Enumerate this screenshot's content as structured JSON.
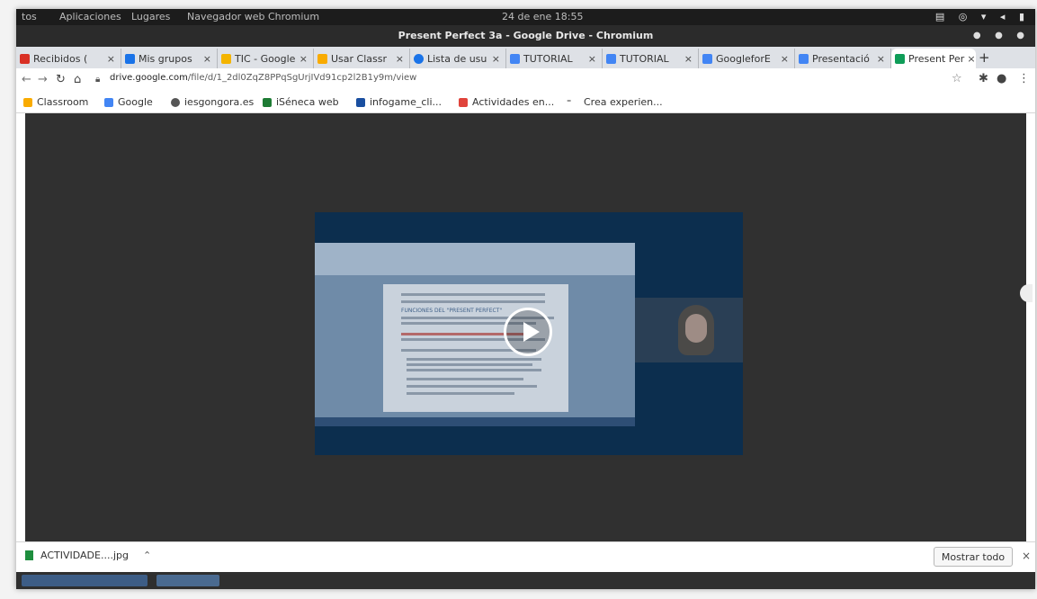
{
  "topbar": {
    "activities": "tos",
    "menu_apps": "Aplicaciones",
    "menu_places": "Lugares",
    "menu_browser": "Navegador web Chromium",
    "clock": "24 de ene 18:55"
  },
  "window": {
    "title": "Present Perfect 3a - Google Drive - Chromium"
  },
  "tabs": [
    {
      "label": "Recibidos (",
      "icon": "gmail-icon",
      "color": "#d93025"
    },
    {
      "label": "Mis grupos",
      "icon": "groups-icon",
      "color": "#1a73e8"
    },
    {
      "label": "TIC - Google",
      "icon": "drive-icon",
      "color": "#f4b400"
    },
    {
      "label": "Usar Classr",
      "icon": "classroom-icon",
      "color": "#f9ab00"
    },
    {
      "label": "Lista de usu",
      "icon": "chrome-icon",
      "color": "#1a73e8"
    },
    {
      "label": "TUTORIAL",
      "icon": "docs-icon",
      "color": "#4285f4"
    },
    {
      "label": "TUTORIAL",
      "icon": "docs-icon",
      "color": "#4285f4"
    },
    {
      "label": "GoogleforE",
      "icon": "docs-icon",
      "color": "#4285f4"
    },
    {
      "label": "Presentació",
      "icon": "person-icon",
      "color": "#4285f4"
    },
    {
      "label": "Present Per",
      "icon": "drive-icon",
      "color": "#0f9d58"
    }
  ],
  "address": {
    "url_domain": "drive.google.com",
    "url_path": "/file/d/1_2dl0ZqZ8PPqSgUrjIVd91cp2l2B1y9m/view"
  },
  "bookmarks": [
    {
      "label": "Classroom",
      "icon": "classroom-icon",
      "color": "#f9ab00"
    },
    {
      "label": "Google",
      "icon": "google-icon",
      "color": "#4285f4"
    },
    {
      "label": "iesgongora.es",
      "icon": "globe-icon",
      "color": "#555555"
    },
    {
      "label": "iSéneca web",
      "icon": "seneca-icon",
      "color": "#1e7b34"
    },
    {
      "label": "infogame_cli...",
      "icon": "infogame-icon",
      "color": "#1a4fa0"
    },
    {
      "label": "Actividades en...",
      "icon": "actividades-icon",
      "color": "#e0433b"
    },
    {
      "label": "Crea experien...",
      "icon": "genially-icon",
      "color": "#333333"
    }
  ],
  "video": {
    "doc_heading": "FUNCIONES DEL \"PRESENT PERFECT\""
  },
  "downloads": {
    "file": "ACTIVIDADE....jpg",
    "show_all": "Mostrar todo"
  }
}
